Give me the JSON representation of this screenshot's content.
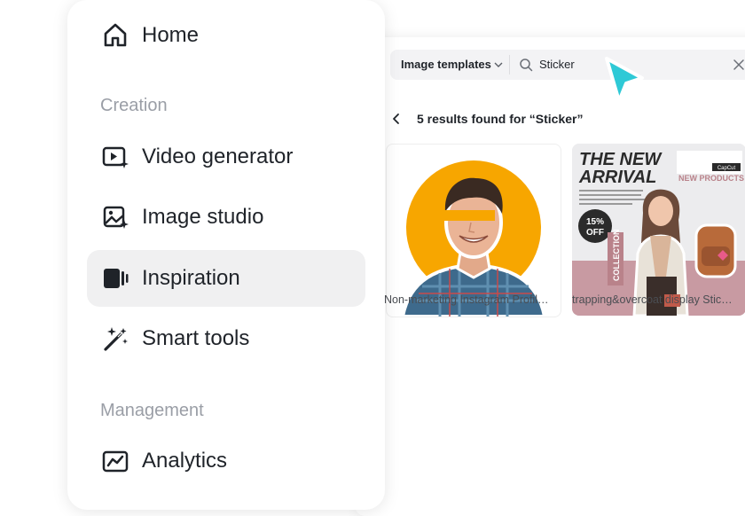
{
  "nav": {
    "items": [
      {
        "label": "Home",
        "icon": "home-icon"
      },
      {
        "label": "Video generator",
        "icon": "video-generator-icon"
      },
      {
        "label": "Image studio",
        "icon": "image-studio-icon"
      },
      {
        "label": "Inspiration",
        "icon": "inspiration-icon",
        "active": true
      },
      {
        "label": "Smart tools",
        "icon": "magic-wand-icon"
      },
      {
        "label": "Analytics",
        "icon": "analytics-icon"
      }
    ],
    "sections": {
      "creation": "Creation",
      "management": "Management"
    }
  },
  "search": {
    "category": "Image templates",
    "query": "Sticker"
  },
  "results": {
    "summary": "5 results found for “Sticker”",
    "cards": [
      {
        "title": "Non-marketing Instagram Profil…",
        "accent": "#f7a600"
      },
      {
        "title": "trapping&overcoat display Stic…",
        "headline_1": "THE NEW",
        "headline_2": "ARRIVAL",
        "tag": "NEW PRODUCTS",
        "badge_line1": "15%",
        "badge_line2": "OFF",
        "side_text": "COLLECTION",
        "brand": "CapCut",
        "accent": "#b9828a"
      }
    ]
  },
  "colors": {
    "accent_cursor": "#2ec9d6",
    "active_bg": "#f0f0f1"
  }
}
